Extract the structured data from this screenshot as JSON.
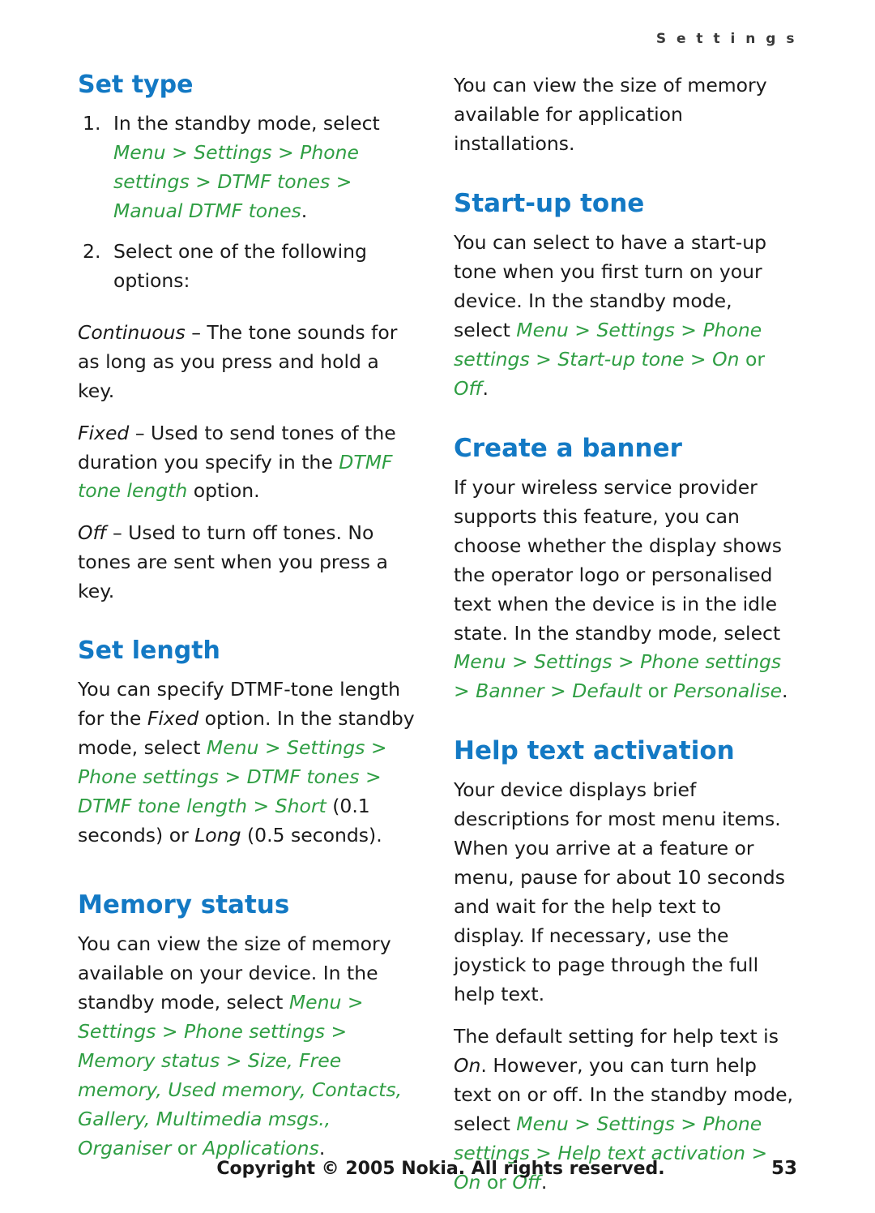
{
  "header": {
    "running_head": "S e t t i n g s"
  },
  "left_column": {
    "set_type": {
      "heading": "Set type",
      "step1_num": "1.",
      "step1_text": "In the standby mode, select ",
      "step1_path": "Menu > Settings > Phone settings > DTMF tones > Manual DTMF tones",
      "step1_period": ".",
      "step2_num": "2.",
      "step2_text": "Select one of the following options:",
      "opt1_term": "Continuous",
      "opt1_def": " – The tone sounds for as long as you press and hold a key.",
      "opt2_term": "Fixed",
      "opt2_def_a": " – Used to send tones of the duration you specify in the ",
      "opt2_def_italic": "DTMF tone length",
      "opt2_def_b": " option.",
      "opt3_term": "Off",
      "opt3_def": " – Used to turn off tones. No tones are sent when you press a key."
    },
    "set_length": {
      "heading": "Set length",
      "p1_a": "You can specify DTMF-tone length for the ",
      "p1_fixed": "Fixed",
      "p1_b": " option. In the standby mode, select ",
      "p1_path_a": "Menu > Settings > Phone settings > DTMF tones > DTMF tone length > Short",
      "p1_c": " (0.1 seconds) or ",
      "p1_long": "Long",
      "p1_d": " (0.5 seconds)."
    },
    "memory_status": {
      "heading": "Memory status",
      "p1_a": "You can view the size of memory available on your device. In the standby mode, select ",
      "p1_path": "Menu > Settings > Phone settings > Memory status > Size, Free memory, Used memory, Contacts, Gallery, Multimedia msgs., Organiser",
      "p1_or": " or ",
      "p1_applications": "Applications",
      "p1_end": "."
    }
  },
  "right_column": {
    "intro": {
      "text": "You can view the size of memory available for application installations."
    },
    "startup_tone": {
      "heading": "Start-up tone",
      "p1_a": "You can select to have a start-up tone when you first turn on your device. In the standby mode, select ",
      "p1_path": "Menu > Settings > Phone settings > Start-up tone > On",
      "p1_or": " or ",
      "p1_off": "Off",
      "p1_end": "."
    },
    "create_banner": {
      "heading": "Create a banner",
      "p1_a": "If your wireless service provider supports this feature, you can choose whether the display shows the operator logo or personalised text when the device is in the idle state. In the standby mode, select ",
      "p1_path": "Menu > Settings > Phone settings > Banner > Default",
      "p1_or": " or ",
      "p1_personalise": "Personalise",
      "p1_end": "."
    },
    "help_text_activation": {
      "heading": "Help text activation",
      "p1": "Your device displays brief descriptions for most menu items. When you arrive at a feature or menu, pause for about 10 seconds and wait for the help text to display. If necessary, use the joystick to page through the full help text.",
      "p2_a": "The default setting for help text is ",
      "p2_on": "On",
      "p2_b": ". However, you can turn help text on or off. In the standby mode, select ",
      "p2_path": "Menu > Settings > Phone settings > Help text activation > On",
      "p2_or": " or ",
      "p2_off": "Off",
      "p2_end": "."
    }
  },
  "footer": {
    "copyright": "Copyright © 2005 Nokia. All rights reserved.",
    "page_number": "53"
  },
  "colors": {
    "heading_blue": "#1379c4",
    "path_green": "#2f9e43",
    "body_text": "#1a1a1a"
  }
}
